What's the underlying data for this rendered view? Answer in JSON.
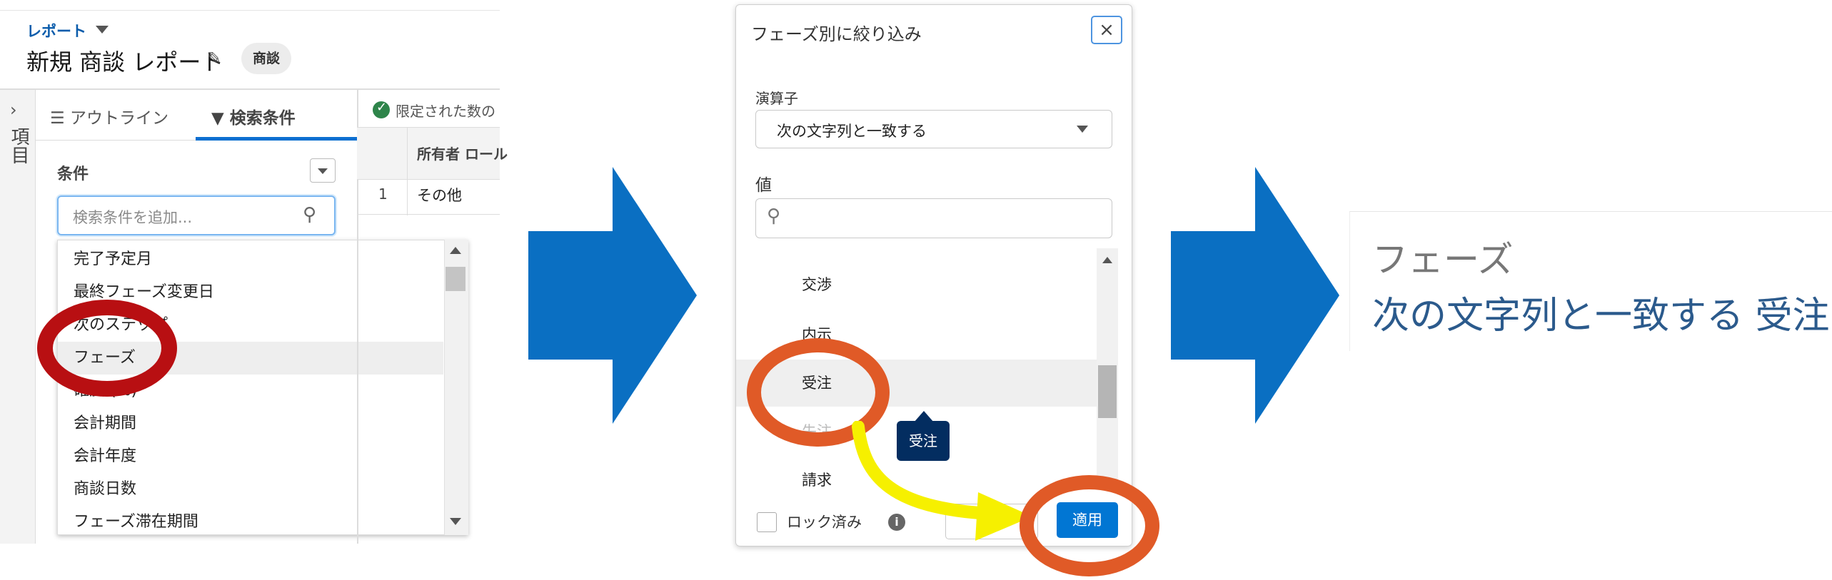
{
  "report": {
    "breadcrumb": "レポート",
    "title": "新規 商談 レポート",
    "type_badge": "商談",
    "side_rail_label": "項目",
    "tabs": {
      "outline": "アウトライン",
      "filters": "検索条件"
    },
    "conditions_label": "条件",
    "search_placeholder": "検索条件を追加...",
    "field_list": [
      "完了予定月",
      "最終フェーズ変更日",
      "次のステップ",
      "フェーズ",
      "確度 (%)",
      "会計期間",
      "会計年度",
      "商談日数",
      "フェーズ滞在期間"
    ],
    "selected_field": "フェーズ",
    "preview_status": "限定された数の",
    "table": {
      "column": "所有者 ロール",
      "rows": [
        {
          "num": "1",
          "value": "その他"
        }
      ]
    }
  },
  "dialog": {
    "title": "フェーズ別に絞り込み",
    "operator_label": "演算子",
    "operator_value": "次の文字列と一致する",
    "value_label": "値",
    "options": [
      "交渉",
      "内示",
      "受注",
      "失注",
      "請求"
    ],
    "selected_option": "受注",
    "tooltip": "受注",
    "locked_label": "ロック済み",
    "info_icon": "i",
    "apply_label": "適用",
    "close_icon": "×"
  },
  "result": {
    "field": "フェーズ",
    "condition": "次の文字列と一致する 受注"
  },
  "colors": {
    "arrow_blue": "#0a6fc2",
    "red_highlight": "#b80f12",
    "orange_highlight": "#e05a27",
    "yellow_arrow": "#f6f000",
    "brand_blue": "#0176d3"
  }
}
